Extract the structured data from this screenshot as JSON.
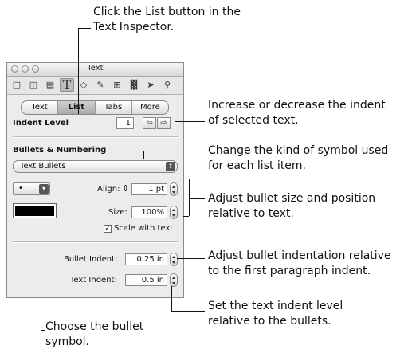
{
  "callouts": {
    "top_line1": "Click the List button in the",
    "top_line2": "Text Inspector.",
    "indent_line1": "Increase or decrease the indent",
    "indent_line2": "of selected text.",
    "kind_line1": "Change the kind of symbol used",
    "kind_line2": "for each list item.",
    "size_line1": "Adjust bullet size and position",
    "size_line2": "relative to text.",
    "bindent_line1": "Adjust bullet indentation relative",
    "bindent_line2": "to the first paragraph indent.",
    "tindent_line1": "Set the text indent level",
    "tindent_line2": "relative to the bullets.",
    "symbol_line1": "Choose the bullet",
    "symbol_line2": "symbol."
  },
  "window": {
    "title": "Text",
    "toolbar_icons": [
      "document-icon",
      "layout-icon",
      "wrap-icon",
      "text-icon",
      "graphic-icon",
      "metrics-icon",
      "table-icon",
      "chart-icon",
      "link-icon",
      "quicktime-icon"
    ]
  },
  "tabs": [
    "Text",
    "List",
    "Tabs",
    "More"
  ],
  "selected_tab": "List",
  "indent": {
    "label": "Indent Level",
    "value": "1"
  },
  "bullets": {
    "section_label": "Bullets & Numbering",
    "type_value": "Text Bullets",
    "symbol_value": "•",
    "align_label": "Align:",
    "align_value": "1 pt",
    "size_label": "Size:",
    "size_value": "100%",
    "scale_label": "Scale with text",
    "scale_checked": true,
    "color": "#000000"
  },
  "indents": {
    "bullet_label": "Bullet Indent:",
    "bullet_value": "0.25 in",
    "text_label": "Text Indent:",
    "text_value": "0.5 in"
  }
}
